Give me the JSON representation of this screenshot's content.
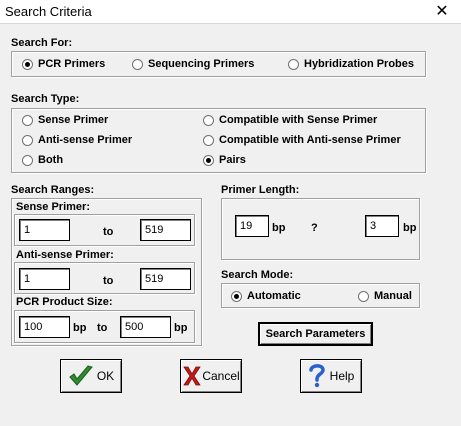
{
  "window": {
    "title": "Search Criteria",
    "close_glyph": "✕"
  },
  "search_for": {
    "label": "Search For:",
    "options": [
      {
        "label": "PCR Primers",
        "selected": true
      },
      {
        "label": "Sequencing Primers",
        "selected": false
      },
      {
        "label": "Hybridization Probes",
        "selected": false
      }
    ]
  },
  "search_type": {
    "label": "Search Type:",
    "options": [
      {
        "label": "Sense Primer",
        "selected": false
      },
      {
        "label": "Anti-sense Primer",
        "selected": false
      },
      {
        "label": "Both",
        "selected": false
      },
      {
        "label": "Compatible with Sense Primer",
        "selected": false
      },
      {
        "label": "Compatible with Anti-sense Primer",
        "selected": false
      },
      {
        "label": "Pairs",
        "selected": true
      }
    ]
  },
  "search_ranges": {
    "label": "Search Ranges:",
    "sense_primer": {
      "label": "Sense Primer:",
      "from": "1",
      "to_label": "to",
      "to": "519"
    },
    "antisense_primer": {
      "label": "Anti-sense Primer:",
      "from": "1",
      "to_label": "to",
      "to": "519"
    },
    "pcr_product_size": {
      "label": "PCR Product Size:",
      "from": "100",
      "from_unit": "bp",
      "to_label": "to",
      "to": "500",
      "to_unit": "bp"
    }
  },
  "primer_length": {
    "label": "Primer Length:",
    "min": "19",
    "min_unit": "bp",
    "separator": "?",
    "max": "3",
    "max_unit": "bp"
  },
  "search_mode": {
    "label": "Search Mode:",
    "options": [
      {
        "label": "Automatic",
        "selected": true
      },
      {
        "label": "Manual",
        "selected": false
      }
    ]
  },
  "buttons": {
    "search_parameters": "Search Parameters",
    "ok": "OK",
    "cancel": "Cancel",
    "help": "Help"
  },
  "icons": {
    "ok": "check-icon",
    "cancel": "x-icon",
    "help": "question-icon"
  },
  "colors": {
    "ok_icon": "#2e8b2e",
    "cancel_icon": "#c81818",
    "help_icon": "#2a5fd0"
  }
}
